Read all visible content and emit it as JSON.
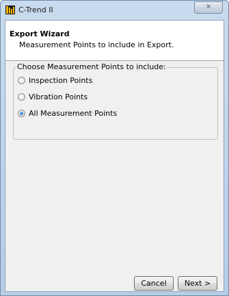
{
  "window": {
    "title": "C-Trend II",
    "close_glyph": "✕",
    "icon": "c-trend-app-icon"
  },
  "wizard": {
    "title": "Export Wizard",
    "subtitle": "Measurement Points to include in Export."
  },
  "group": {
    "label": "Choose Measurement Points to include:",
    "options": [
      {
        "label": "Inspection Points",
        "checked": false
      },
      {
        "label": "Vibration Points",
        "checked": false
      },
      {
        "label": "All Measurement Points",
        "checked": true
      }
    ]
  },
  "buttons": {
    "cancel": "Cancel",
    "next": "Next >"
  },
  "colors": {
    "radio_selected": "#2a6fc4",
    "window_frame": "#b7cde6",
    "app_icon": "#f2b705"
  }
}
